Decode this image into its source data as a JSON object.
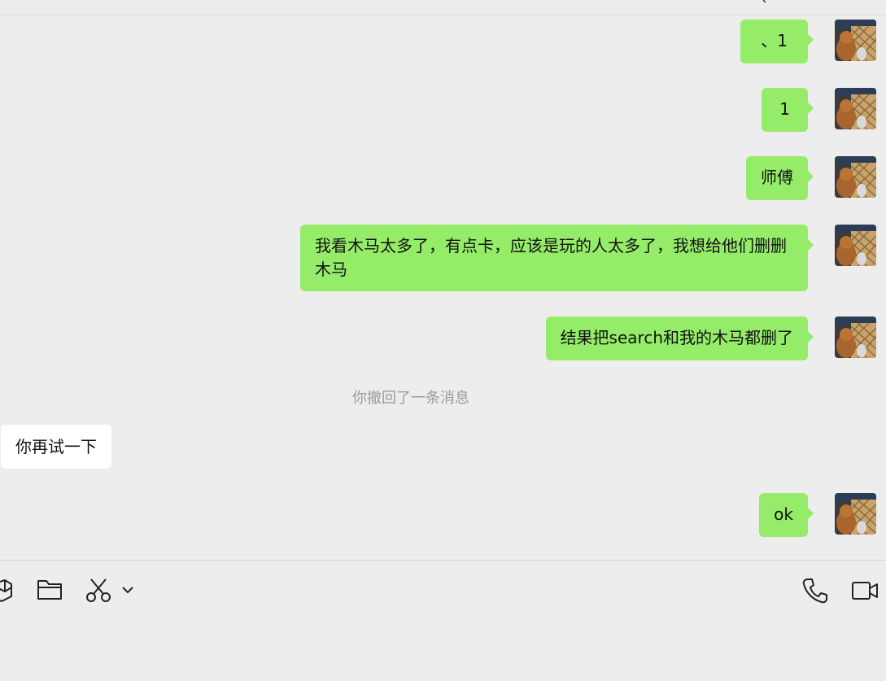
{
  "messages": [
    {
      "side": "sent",
      "text": "、1",
      "avatar": "user-avatar"
    },
    {
      "side": "sent",
      "text": "1",
      "avatar": "user-avatar"
    },
    {
      "side": "sent",
      "text": "师傅",
      "avatar": "user-avatar"
    },
    {
      "side": "sent",
      "text": "我看木马太多了，有点卡，应该是玩的人太多了，我想给他们删删木马",
      "avatar": "user-avatar"
    },
    {
      "side": "sent",
      "text": "结果把search和我的木马都删了",
      "avatar": "user-avatar"
    },
    {
      "side": "system",
      "text": "你撤回了一条消息"
    },
    {
      "side": "received",
      "text": "你再试一下"
    },
    {
      "side": "sent",
      "text": "ok",
      "avatar": "user-avatar"
    }
  ],
  "toolbar": {
    "left_icons": [
      "package-icon",
      "folder-icon",
      "scissors-icon",
      "chevron-down-icon"
    ],
    "right_icons": [
      "phone-icon",
      "video-call-icon"
    ]
  },
  "colors": {
    "background": "#ededed",
    "sent_bubble": "#95ec69",
    "received_bubble": "#ffffff",
    "system_text": "#9a9a9a"
  }
}
